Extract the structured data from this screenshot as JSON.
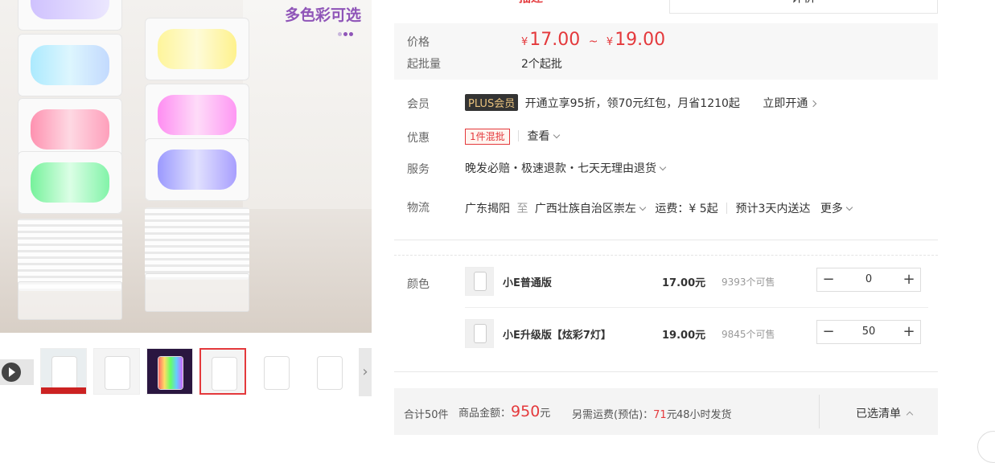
{
  "hero": {
    "tagline": "多色彩可选"
  },
  "tabs": {
    "active": "描述",
    "other": "评价"
  },
  "price_section": {
    "price_label": "价格",
    "currency": "¥",
    "price_low": "17.00",
    "tilde": "~",
    "price_high": "19.00",
    "min_label": "起批量",
    "min_value": "2个起批"
  },
  "member": {
    "label": "会员",
    "badge": "PLUS会员",
    "text": "开通立享95折，领70元红包，月省1210起",
    "link": "立即开通"
  },
  "promo": {
    "label": "优惠",
    "badge": "1件混批",
    "view": "查看"
  },
  "service": {
    "label": "服务",
    "text": "晚发必赔・极速退款・七天无理由退货"
  },
  "logistics": {
    "label": "物流",
    "from": "广东揭阳",
    "to_word": "至",
    "to": "广西壮族自治区崇左",
    "fee": "运费：¥ 5起",
    "eta": "预计3天内送达",
    "more": "更多"
  },
  "skus": {
    "label": "颜色",
    "items": [
      {
        "name": "小E普通版",
        "price": "17.00元",
        "stock": "9393个可售",
        "qty": "0"
      },
      {
        "name": "小E升级版【炫彩7灯】",
        "price": "19.00元",
        "stock": "9845个可售",
        "qty": "50"
      }
    ],
    "minus": "−",
    "plus": "+"
  },
  "footer": {
    "total_count": "合计50件",
    "amount_label": "商品金额：",
    "amount_value": "950",
    "amount_unit": "元",
    "shipping_label": "另需运费(预估)：",
    "shipping_value": "71",
    "shipping_unit": "元",
    "ship_time": "48小时发货",
    "selected_list": "已选清单"
  },
  "colors": {
    "accent": "#e4393c",
    "purple": "#8f55b8"
  }
}
